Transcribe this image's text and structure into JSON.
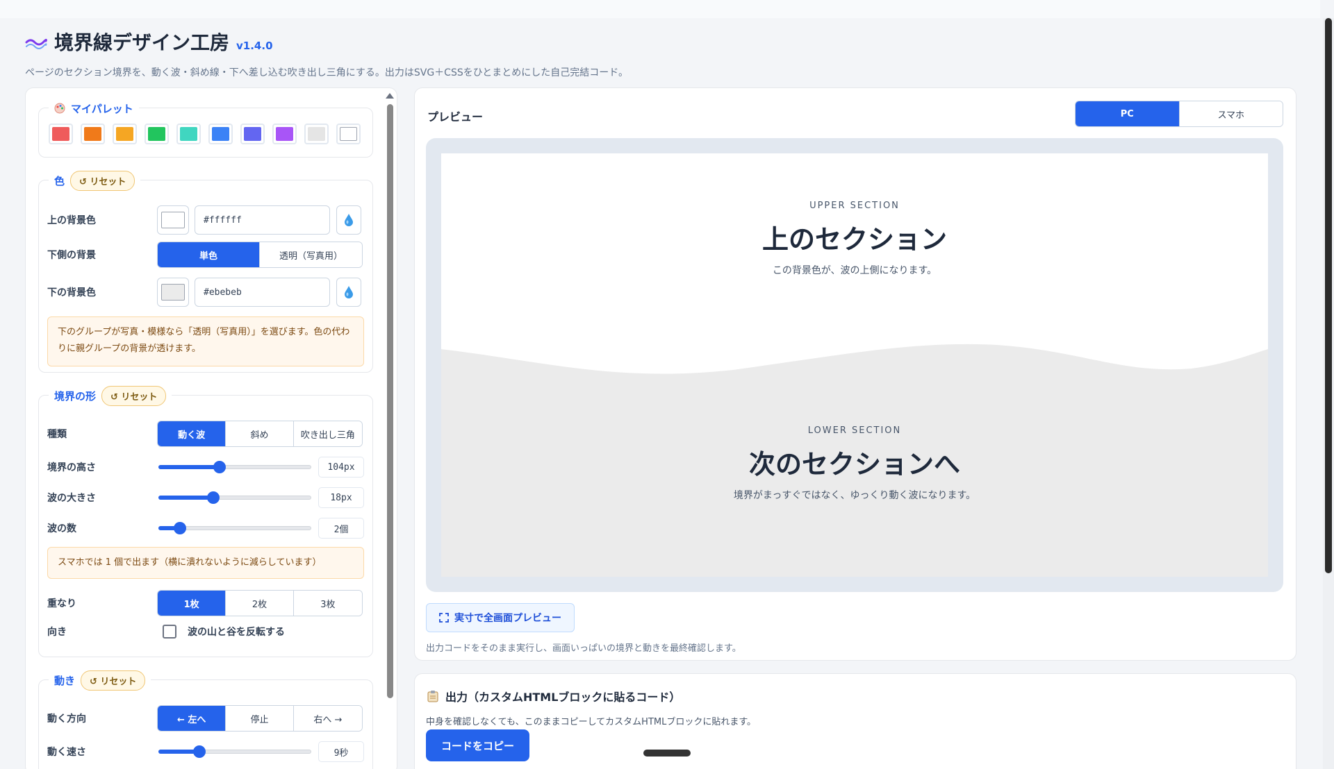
{
  "app": {
    "title": "境界線デザイン工房",
    "version": "v1.4.0",
    "subtitle": "ページのセクション境界を、動く波・斜め線・下へ差し込む吹き出し三角にする。出力はSVG＋CSSをひとまとめにした自己完結コード。"
  },
  "palette": {
    "legend": "マイパレット",
    "swatches": [
      "#ef5b5b",
      "#f07a1a",
      "#f5a623",
      "#22c55e",
      "#40d6c0",
      "#3b82f6",
      "#6366f1",
      "#a855f7",
      "#e5e5e5",
      "#ffffff"
    ]
  },
  "color": {
    "legend": "色",
    "reset_label": "↺ リセット",
    "upper_bg_label": "上の背景色",
    "upper_bg_value": "#ffffff",
    "lower_mode_label": "下側の背景",
    "lower_mode_options": [
      "単色",
      "透明（写真用）"
    ],
    "lower_mode_selected": "単色",
    "lower_bg_label": "下の背景色",
    "lower_bg_value": "#ebebeb",
    "note": "下のグループが写真・模様なら「透明（写真用）」を選びます。色の代わりに親グループの背景が透けます。"
  },
  "shape": {
    "legend": "境界の形",
    "reset_label": "↺ リセット",
    "type_label": "種類",
    "type_options": [
      "動く波",
      "斜め",
      "吹き出し三角"
    ],
    "type_selected": "動く波",
    "height_label": "境界の高さ",
    "height_value": "104px",
    "height_fraction": 0.4,
    "amp_label": "波の大きさ",
    "amp_value": "18px",
    "amp_fraction": 0.36,
    "count_label": "波の数",
    "count_value": "2個",
    "count_fraction": 0.14,
    "mobile_note": "スマホでは 1 個で出ます（横に潰れないように減らしています）",
    "layers_label": "重なり",
    "layers_options": [
      "1枚",
      "2枚",
      "3枚"
    ],
    "layers_selected": "1枚",
    "direction_label": "向き",
    "invert_label": "波の山と谷を反転する",
    "invert_checked": false
  },
  "motion": {
    "legend": "動き",
    "reset_label": "↺ リセット",
    "dir_label": "動く方向",
    "dir_options": [
      "← 左へ",
      "停止",
      "右へ →"
    ],
    "dir_selected": "← 左へ",
    "speed_label": "動く速さ",
    "speed_value": "9秒",
    "speed_fraction": 0.27
  },
  "preview": {
    "title": "プレビュー",
    "device_options": [
      "PC",
      "スマホ"
    ],
    "device_selected": "PC",
    "upper_eyebrow": "UPPER SECTION",
    "upper_title": "上のセクション",
    "upper_desc": "この背景色が、波の上側になります。",
    "lower_eyebrow": "LOWER SECTION",
    "lower_title": "次のセクションへ",
    "lower_desc": "境界がまっすぐではなく、ゆっくり動く波になります。",
    "fullscreen_label": "実寸で全画面プレビュー",
    "fullscreen_note": "出力コードをそのまま実行し、画面いっぱいの境界と動きを最終確認します。"
  },
  "output": {
    "title": "出力（カスタムHTMLブロックに貼るコード）",
    "desc": "中身を確認しなくても、このままコピーしてカスタムHTMLブロックに貼れます。",
    "copy_label": "コードをコピー"
  }
}
